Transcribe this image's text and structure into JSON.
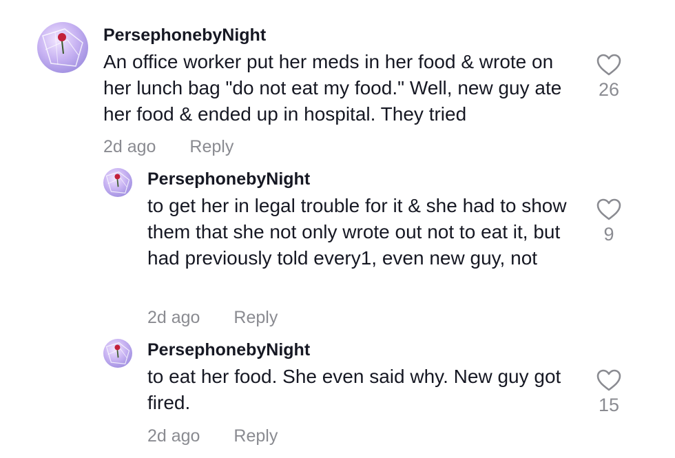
{
  "comments": [
    {
      "username": "PersephonebyNight",
      "text": "An office worker put her meds in her food & wrote on her lunch bag \"do not eat my food.\" Well, new guy ate her food & ended up in hospital. They tried",
      "time": "2d ago",
      "reply_label": "Reply",
      "likes": "26",
      "is_reply": false
    },
    {
      "username": "PersephonebyNight",
      "text": "to get her in legal trouble for it & she had to show them that she not only wrote out not to eat it, but had previously told every1, even new guy, not",
      "time": "2d ago",
      "reply_label": "Reply",
      "likes": "9",
      "is_reply": true
    },
    {
      "username": "PersephonebyNight",
      "text": "to eat her food. She even said why. New guy got fired.",
      "time": "2d ago",
      "reply_label": "Reply",
      "likes": "15",
      "is_reply": true
    }
  ],
  "icons": {
    "like": "heart-outline-icon",
    "avatar": "profile-avatar"
  },
  "colors": {
    "text": "#161823",
    "secondary": "#8a8b91",
    "avatar_bg": "#c9b8f0"
  }
}
